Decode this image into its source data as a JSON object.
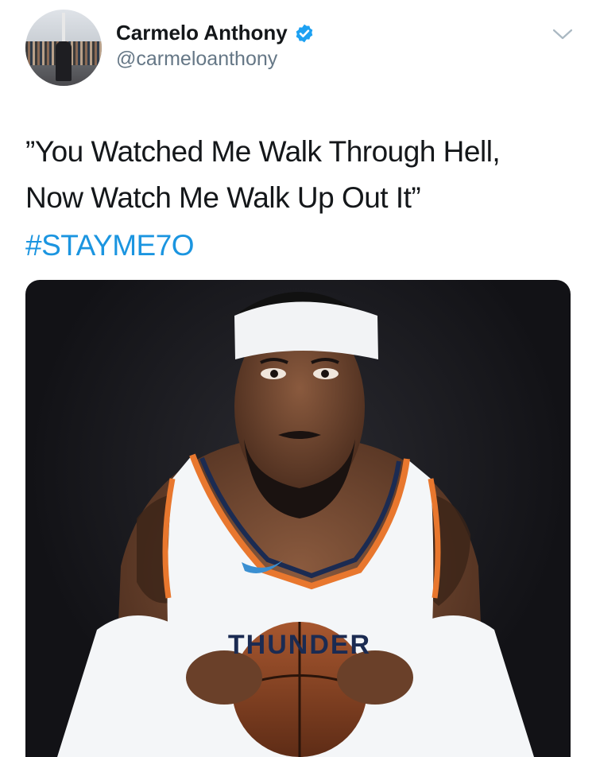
{
  "tweet": {
    "author": {
      "name": "Carmelo Anthony",
      "handle": "@carmeloanthony",
      "verified": true,
      "verified_color": "#1da1f2"
    },
    "text_lines": [
      "”You Watched Me Walk Through Hell,",
      "Now Watch Me Walk Up Out It”"
    ],
    "hashtag": "#STAYME7O",
    "hashtag_color": "#1b95e0",
    "menu_icon": "chevron-down-icon",
    "media": {
      "jersey_text": "THUNDER"
    }
  }
}
